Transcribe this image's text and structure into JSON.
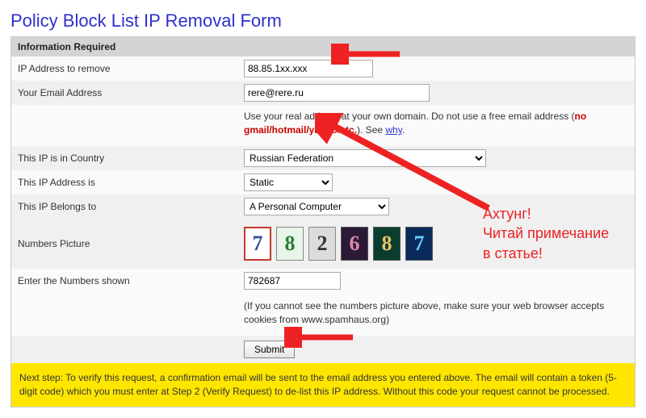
{
  "title": "Policy Block List IP Removal Form",
  "section_header": "Information Required",
  "rows": {
    "ip_label": "IP Address to remove",
    "ip_value": "88.85.1xx.xxx",
    "email_label": "Your Email Address",
    "email_value": "rere@rere.ru",
    "email_hint_pre": "Use your real address at your own domain. Do not use a free email address (",
    "email_hint_red": "no gmail/hotmail/yahoo/etc.",
    "email_hint_post": "). See ",
    "email_hint_link": "why",
    "email_hint_end": ".",
    "country_label": "This IP is in Country",
    "country_value": "Russian Federation",
    "static_label": "This IP Address is",
    "static_value": "Static",
    "belongs_label": "This IP Belongs to",
    "belongs_value": "A Personal Computer",
    "captcha_label": "Numbers Picture",
    "captcha_digits": [
      "7",
      "8",
      "2",
      "6",
      "8",
      "7"
    ],
    "enter_label": "Enter the Numbers shown",
    "enter_value": "782687",
    "cookie_hint": "(If you cannot see the numbers picture above, make sure your web browser accepts cookies from www.spamhaus.org)",
    "submit_label": "Submit"
  },
  "next_step": "Next step: To verify this request, a confirmation email will be sent to the email address you entered above. The email will contain a token (5-digit code) which you must enter at Step 2 (Verify Request) to de-list this IP address. Without this code your request cannot be processed.",
  "annotation": {
    "line1": "Ахтунг!",
    "line2": "Читай примечание",
    "line3": "в статье!"
  },
  "captcha_styles": [
    {
      "bg": "#ffffff",
      "fg": "#3b4fa0",
      "border": "2px solid #c0392b"
    },
    {
      "bg": "#e8f5e9",
      "fg": "#2e7d32",
      "border": "1px solid #888"
    },
    {
      "bg": "#dcdcdc",
      "fg": "#333",
      "border": "1px solid #888"
    },
    {
      "bg": "#2b1a36",
      "fg": "#d8a",
      "border": "1px solid #555"
    },
    {
      "bg": "#0b3d2e",
      "fg": "#e6c36a",
      "border": "1px solid #555"
    },
    {
      "bg": "#0a2a5c",
      "fg": "#6cf",
      "border": "1px solid #555"
    }
  ]
}
